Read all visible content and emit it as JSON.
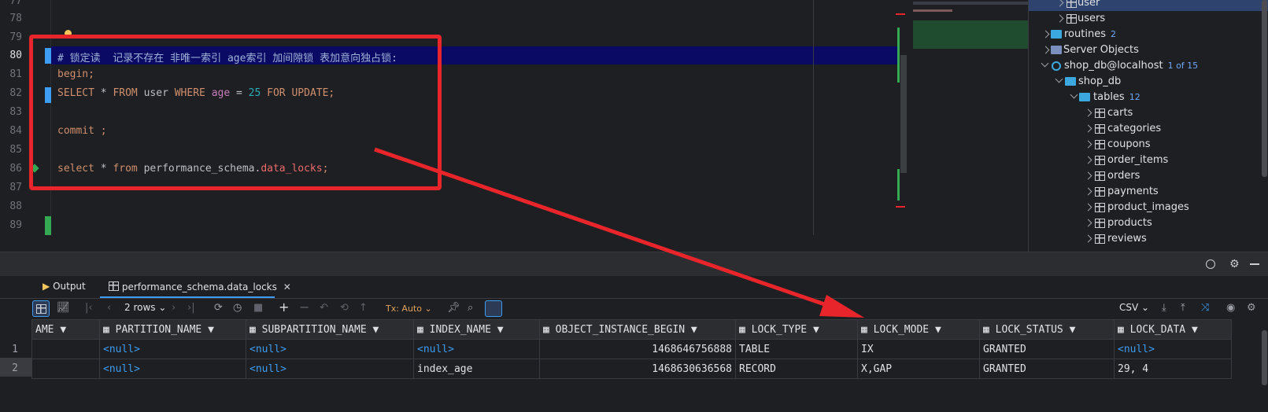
{
  "editor": {
    "line_numbers": [
      "77",
      "78",
      "79",
      "80",
      "81",
      "82",
      "83",
      "84",
      "85",
      "86",
      "87",
      "88",
      "89"
    ],
    "current_line": "80",
    "lines": {
      "l80_comment": "# 锁定读  记录不存在 非唯一索引 age索引 加间隙锁 表加意向独占锁:",
      "l81_begin": "begin;",
      "l82_select": "SELECT",
      "l82_star": " * ",
      "l82_from": "FROM",
      "l82_user": " user ",
      "l82_where": "WHERE",
      "l82_age": " age",
      "l82_eq": " = ",
      "l82_num": "25",
      "l82_for": " FOR UPDATE",
      "l82_semi": ";",
      "l84_commit": "commit ;",
      "l86_select": "select",
      "l86_star": " * ",
      "l86_from": "from",
      "l86_schema": " performance_schema.",
      "l86_table": "data_locks",
      "l86_semi": ";"
    }
  },
  "tree": {
    "items": [
      {
        "label": "user",
        "icon": "table-icon"
      },
      {
        "label": "users",
        "icon": "table-icon"
      },
      {
        "label": "routines",
        "count": "2",
        "icon": "folder-icon"
      },
      {
        "label": "Server Objects",
        "icon": "server-objects-icon"
      },
      {
        "label": "shop_db@localhost",
        "count": "1 of 15",
        "icon": "datasource-icon"
      },
      {
        "label": "shop_db",
        "icon": "schema-icon"
      },
      {
        "label": "tables",
        "count": "12",
        "icon": "folder-icon"
      },
      {
        "label": "carts",
        "icon": "table-icon"
      },
      {
        "label": "categories",
        "icon": "table-icon"
      },
      {
        "label": "coupons",
        "icon": "table-icon"
      },
      {
        "label": "order_items",
        "icon": "table-icon"
      },
      {
        "label": "orders",
        "icon": "table-icon"
      },
      {
        "label": "payments",
        "icon": "table-icon"
      },
      {
        "label": "product_images",
        "icon": "table-icon"
      },
      {
        "label": "products",
        "icon": "table-icon"
      },
      {
        "label": "reviews",
        "icon": "table-icon"
      }
    ]
  },
  "tabs": {
    "output": "Output",
    "result": "performance_schema.data_locks"
  },
  "toolbar": {
    "rows": "2 rows",
    "tx": "Tx: Auto",
    "export": "CSV"
  },
  "grid": {
    "columns": [
      "AME",
      "PARTITION_NAME",
      "SUBPARTITION_NAME",
      "INDEX_NAME",
      "OBJECT_INSTANCE_BEGIN",
      "LOCK_TYPE",
      "LOCK_MODE",
      "LOCK_STATUS",
      "LOCK_DATA"
    ],
    "row_numbers": [
      "1",
      "2"
    ],
    "rows": [
      [
        "",
        "<null>",
        "<null>",
        "<null>",
        "1468646756888",
        "TABLE",
        "IX",
        "GRANTED",
        "<null>"
      ],
      [
        "",
        "<null>",
        "<null>",
        "index_age",
        "1468630636568",
        "RECORD",
        "X,GAP",
        "GRANTED",
        "29, 4"
      ]
    ]
  },
  "colors": {
    "accent": "#3d9df3",
    "annotation": "#e8252b"
  }
}
